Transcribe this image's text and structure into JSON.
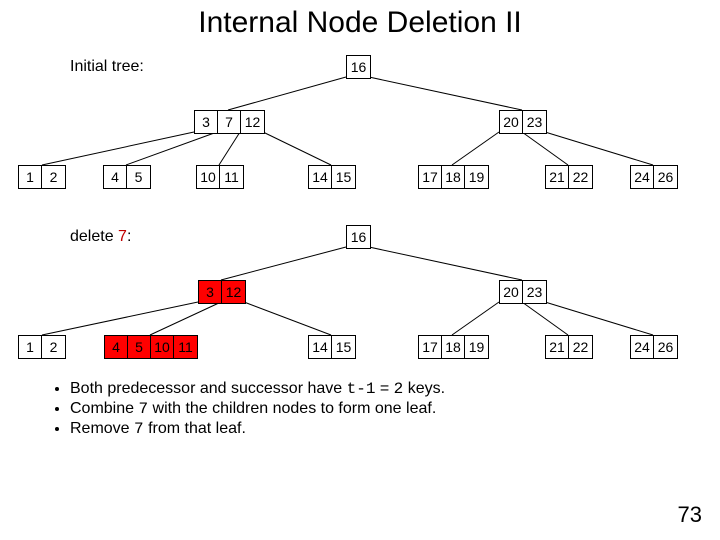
{
  "title": "Internal Node Deletion II",
  "labels": {
    "initial": "Initial tree:",
    "delete_prefix": "delete ",
    "delete_key": "7",
    "delete_suffix": ":"
  },
  "tree1": {
    "root": [
      "16"
    ],
    "mid_left": [
      "3",
      "7",
      "12"
    ],
    "mid_right": [
      "20",
      "23"
    ],
    "leaves": [
      [
        "1",
        "2"
      ],
      [
        "4",
        "5"
      ],
      [
        "10",
        "11"
      ],
      [
        "14",
        "15"
      ],
      [
        "17",
        "18",
        "19"
      ],
      [
        "21",
        "22"
      ],
      [
        "24",
        "26"
      ]
    ]
  },
  "tree2": {
    "root": [
      "16"
    ],
    "mid_left": [
      "3",
      "12"
    ],
    "mid_right": [
      "20",
      "23"
    ],
    "leaves": [
      [
        "1",
        "2"
      ],
      [
        "4",
        "5",
        "10",
        "11"
      ],
      [
        "14",
        "15"
      ],
      [
        "17",
        "18",
        "19"
      ],
      [
        "21",
        "22"
      ],
      [
        "24",
        "26"
      ]
    ]
  },
  "bullets": {
    "b1a": "Both predecessor and successor have ",
    "b1_code": "t-1",
    "b1b": " = ",
    "b1_code2": "2",
    "b1c": " keys.",
    "b2a": "Combine ",
    "b2_code": "7",
    "b2b": " with the children nodes to form one leaf.",
    "b3a": "Remove ",
    "b3_code": "7",
    "b3b": " from that leaf."
  },
  "page": "73"
}
